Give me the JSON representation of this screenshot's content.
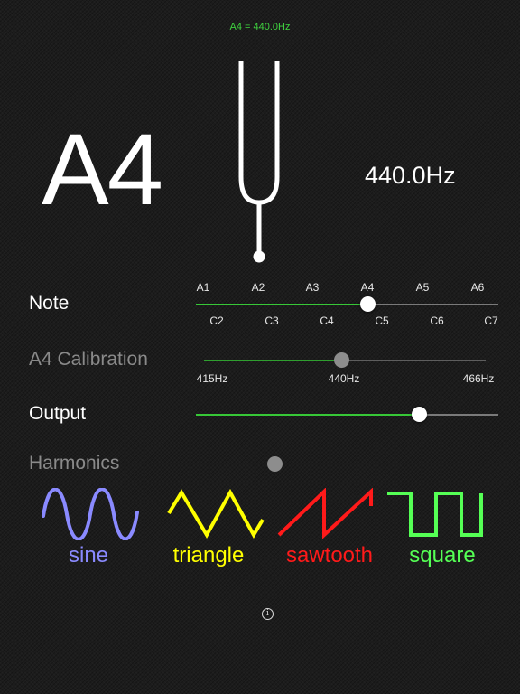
{
  "header": {
    "calibration_readout": "A4 = 440.0Hz"
  },
  "display": {
    "note": "A4",
    "frequency": "440.0Hz"
  },
  "controls": {
    "note": {
      "label": "Note",
      "top_ticks": [
        "A1",
        "A2",
        "A3",
        "A4",
        "A5",
        "A6"
      ],
      "bottom_ticks": [
        "C2",
        "C3",
        "C4",
        "C5",
        "C6",
        "C7"
      ],
      "value_fraction": 0.57
    },
    "calibration": {
      "label": "A4 Calibration",
      "ticks": [
        "415Hz",
        "440Hz",
        "466Hz"
      ],
      "value_fraction": 0.49
    },
    "output": {
      "label": "Output",
      "value_fraction": 0.74
    },
    "harmonics": {
      "label": "Harmonics",
      "value_fraction": 0.26
    }
  },
  "waveforms": [
    {
      "name": "sine",
      "color": "#8a8aff"
    },
    {
      "name": "triangle",
      "color": "#ffff00"
    },
    {
      "name": "sawtooth",
      "color": "#ff1a1a"
    },
    {
      "name": "square",
      "color": "#55ff55"
    }
  ],
  "footer": {
    "info_icon": "info-icon",
    "info_glyph": "i"
  },
  "colors": {
    "accent": "#37c837",
    "track": "#7a7a7a",
    "text_dim": "#8a8a8a"
  }
}
